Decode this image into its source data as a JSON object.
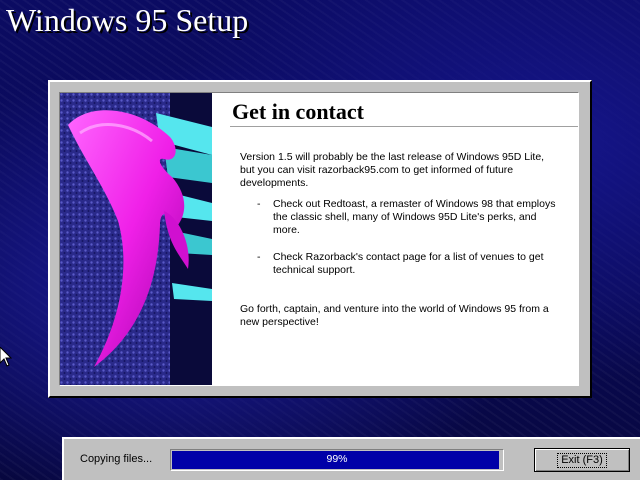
{
  "desktop": {
    "title": "Windows 95 Setup"
  },
  "dialog": {
    "heading": "Get in contact",
    "intro": "Version 1.5 will probably be the last release of Windows 95D Lite, but you can visit razorback95.com to get informed of future developments.",
    "bullets": [
      "Check out Redtoast, a remaster of Windows 98 that employs the classic shell, many of Windows 95D Lite's perks, and more.",
      "Check Razorback's contact page for a list of venues to get technical support."
    ],
    "bullet_marker": "-",
    "closing": "Go forth, captain, and venture into the world of Windows 95 from a new perspective!"
  },
  "status": {
    "label": "Copying files...",
    "progress_percent": 99,
    "progress_text": "99%",
    "exit_label": "Exit (F3)"
  },
  "colors": {
    "desktop_bg": "#0a0a5a",
    "progress_fill": "#0000a8",
    "dialog_face": "#c0c0c0",
    "art_magenta": "#ff33ff",
    "art_cyan": "#55e6ee"
  },
  "icons": {
    "side_art": "dolphin-illustration",
    "cursor": "mouse-pointer-icon"
  }
}
